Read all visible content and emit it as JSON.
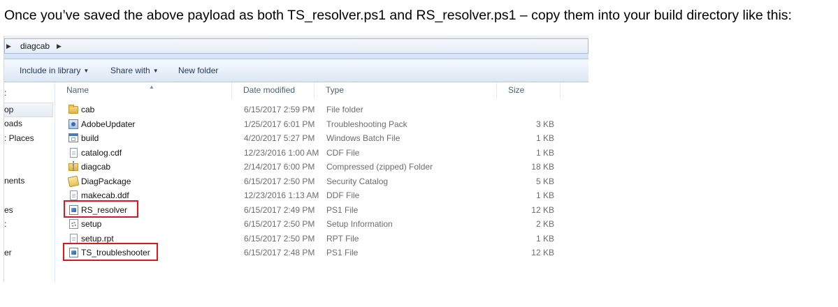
{
  "intro_text": "Once you’ve saved the above payload as both TS_resolver.ps1 and RS_resolver.ps1 – copy them into your build directory like this:",
  "address_bar": {
    "folder": "diagcab"
  },
  "toolbar": {
    "include_in_library": "Include in library",
    "share_with": "Share with",
    "new_folder": "New folder"
  },
  "nav_pane": {
    "items": [
      ":",
      "op",
      "oads",
      ": Places",
      "nents",
      "es",
      ":",
      "er"
    ]
  },
  "columns": {
    "name": "Name",
    "date_modified": "Date modified",
    "type": "Type",
    "size": "Size"
  },
  "files": [
    {
      "name": "cab",
      "date": "6/15/2017 2:59 PM",
      "type": "File folder",
      "size": "",
      "icon": "folder-icon"
    },
    {
      "name": "AdobeUpdater",
      "date": "1/25/2017 6:01 PM",
      "type": "Troubleshooting Pack",
      "size": "3 KB",
      "icon": "troubleshooting-pack-icon"
    },
    {
      "name": "build",
      "date": "4/20/2017 5:27 PM",
      "type": "Windows Batch File",
      "size": "1 KB",
      "icon": "batch-file-icon"
    },
    {
      "name": "catalog.cdf",
      "date": "12/23/2016 1:00 AM",
      "type": "CDF File",
      "size": "1 KB",
      "icon": "document-icon"
    },
    {
      "name": "diagcab",
      "date": "2/14/2017 6:00 PM",
      "type": "Compressed (zipped) Folder",
      "size": "18 KB",
      "icon": "zip-folder-icon"
    },
    {
      "name": "DiagPackage",
      "date": "6/15/2017 2:50 PM",
      "type": "Security Catalog",
      "size": "5 KB",
      "icon": "security-catalog-icon"
    },
    {
      "name": "makecab.ddf",
      "date": "12/23/2016 1:13 AM",
      "type": "DDF File",
      "size": "1 KB",
      "icon": "document-icon"
    },
    {
      "name": "RS_resolver",
      "date": "6/15/2017 2:49 PM",
      "type": "PS1 File",
      "size": "12 KB",
      "icon": "ps1-file-icon",
      "highlighted": true
    },
    {
      "name": "setup",
      "date": "6/15/2017 2:50 PM",
      "type": "Setup Information",
      "size": "2 KB",
      "icon": "setup-info-icon"
    },
    {
      "name": "setup.rpt",
      "date": "6/15/2017 2:50 PM",
      "type": "RPT File",
      "size": "1 KB",
      "icon": "document-icon"
    },
    {
      "name": "TS_troubleshooter",
      "date": "6/15/2017 2:48 PM",
      "type": "PS1 File",
      "size": "12 KB",
      "icon": "ps1-file-icon",
      "highlighted": true
    }
  ],
  "highlight_color": "#e0161b"
}
